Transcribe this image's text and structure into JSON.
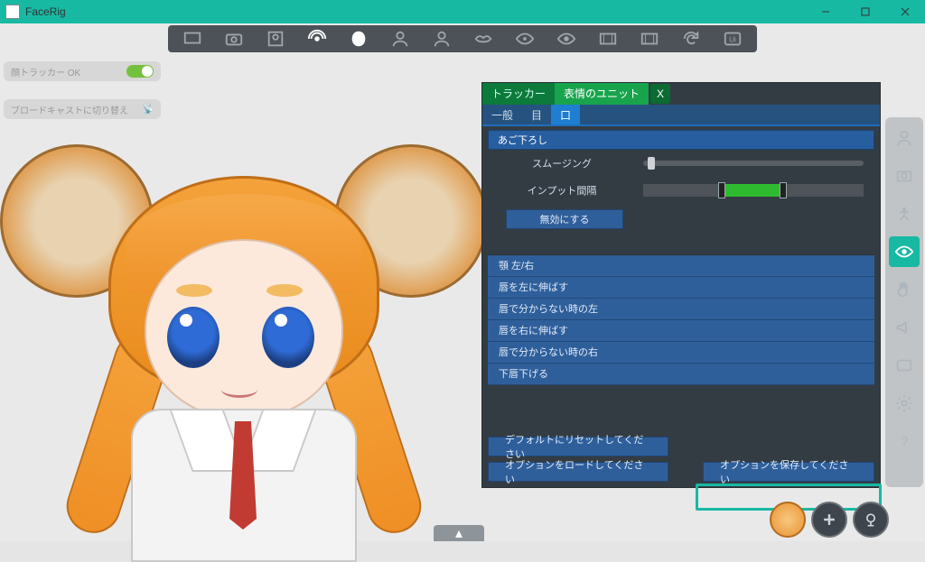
{
  "app": {
    "title": "FaceRig"
  },
  "window": {
    "min": "—",
    "max": "□",
    "close": "×"
  },
  "chips": {
    "tracker": "顔トラッカー OK",
    "broadcast": "ブロードキャストに切り替え"
  },
  "panel": {
    "tabs": {
      "tracker": "トラッカー",
      "units": "表情のユニット"
    },
    "subtabs": {
      "general": "一般",
      "eye": "目",
      "mouth": "口"
    },
    "section": "あご下ろし",
    "smoothing": "スムージング",
    "input_interval": "インプット間隔",
    "disable": "無効にする",
    "items": [
      "顎 左/右",
      "唇を左に伸ばす",
      "唇で分からない時の左",
      "唇を右に伸ばす",
      "唇で分からない時の右",
      "下唇下げる"
    ],
    "reset": "デフォルトにリセットしてください",
    "load": "オプションをロードしてください",
    "save": "オプションを保存してください"
  },
  "sliders": {
    "smoothing_pct": 2,
    "range_lo_pct": 34,
    "range_hi_pct": 62
  }
}
